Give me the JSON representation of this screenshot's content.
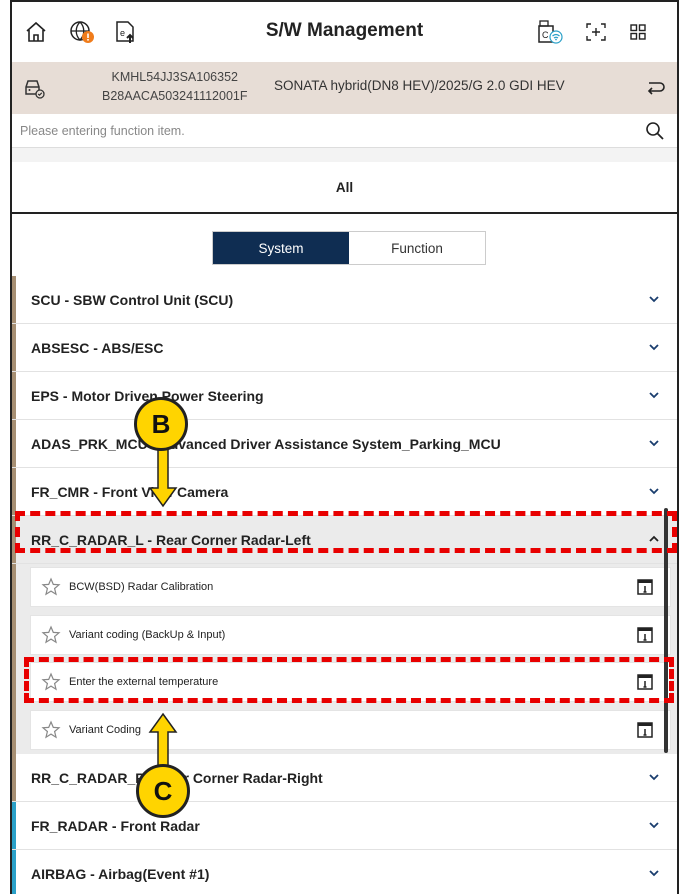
{
  "header": {
    "title": "S/W Management",
    "left_icons": [
      "home-icon",
      "globe-alert-icon",
      "upload-icon"
    ],
    "right_icons": [
      "vci-wifi-icon",
      "capture-icon",
      "grid-menu-icon"
    ]
  },
  "vehicle": {
    "vin": "KMHL54JJ3SA106352",
    "code": "B28AACA503241112001F",
    "model": "SONATA hybrid(DN8 HEV)/2025/G 2.0 GDI HEV"
  },
  "search": {
    "placeholder": "Please entering function item."
  },
  "tabs": {
    "all": "All"
  },
  "toggle": {
    "system": "System",
    "function": "Function"
  },
  "systems": [
    {
      "label": "SCU - SBW Control Unit (SCU)",
      "color": "#a68f73"
    },
    {
      "label": "ABSESC - ABS/ESC",
      "color": "#a68f73"
    },
    {
      "label": "EPS - Motor Driven Power Steering",
      "color": "#a68f73"
    },
    {
      "label": "ADAS_PRK_MCU - Advanced Driver Assistance System_Parking_MCU",
      "color": "#a68f73"
    },
    {
      "label": "FR_CMR - Front View Camera",
      "color": "#a68f73"
    },
    {
      "label": "RR_C_RADAR_L - Rear Corner Radar-Left",
      "color": "#a68f73",
      "expanded": true
    },
    {
      "label": "RR_C_RADAR_R - Rear Corner Radar-Right",
      "color": "#a68f73"
    },
    {
      "label": "FR_RADAR - Front Radar",
      "color": "#2aa0c8"
    },
    {
      "label": "AIRBAG - Airbag(Event #1)",
      "color": "#2aa0c8"
    }
  ],
  "functions": [
    "BCW(BSD) Radar Calibration",
    "Variant coding (BackUp & Input)",
    "Enter the external temperature",
    "Variant Coding"
  ],
  "annotations": {
    "b": "B",
    "c": "C"
  },
  "colors": {
    "accent": "#0f2d52",
    "highlight": "#e80000",
    "callout": "#ffd400"
  }
}
